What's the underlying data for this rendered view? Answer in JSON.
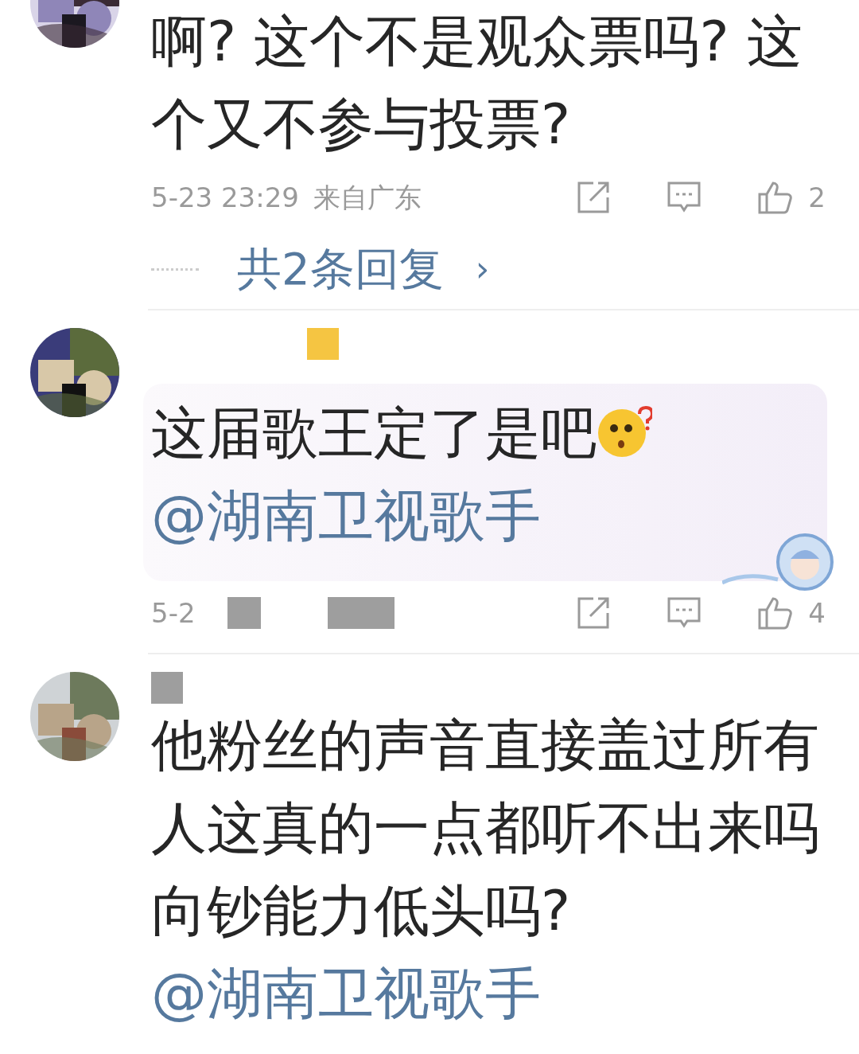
{
  "comments": [
    {
      "text": "啊? 这个不是观众票吗? 这个又不参与投票?",
      "meta": {
        "time": "5-23 23:29",
        "location": "来自广东",
        "likes": "2"
      },
      "replies": {
        "label": "共2条回复",
        "chevron": "›"
      }
    },
    {
      "name_hidden": true,
      "decorated": true,
      "text": "这届歌王定了是吧",
      "emoji_shown": true,
      "mention": "@湖南卫视歌手",
      "meta": {
        "time": "5-2",
        "likes": "4"
      },
      "time_hidden": true
    },
    {
      "name_hidden": true,
      "text": "他粉丝的声音直接盖过所有人这真的一点都听不出来吗向钞能力低头吗?",
      "mention": "@湖南卫视歌手"
    }
  ]
}
